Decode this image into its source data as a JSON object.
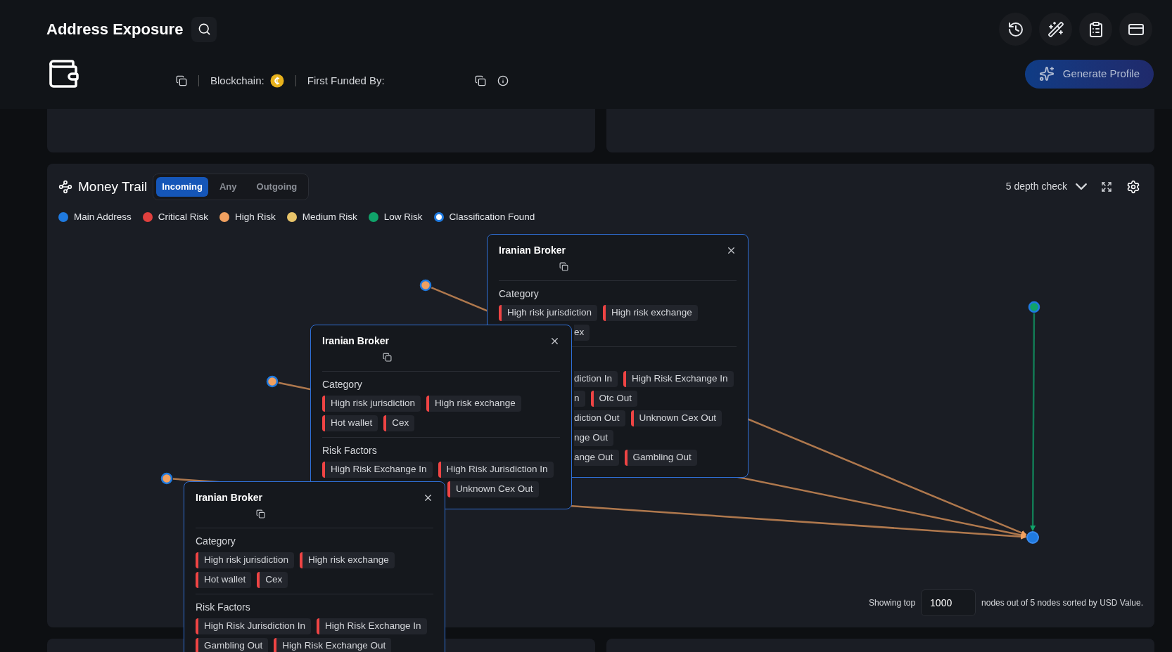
{
  "header": {
    "title": "Address Exposure",
    "blockchain_label": "Blockchain:",
    "funded_label": "First Funded By:",
    "generate_button": "Generate Profile"
  },
  "money_trail": {
    "title": "Money Trail",
    "tabs": [
      {
        "label": "Incoming",
        "selected": true
      },
      {
        "label": "Any",
        "selected": false
      },
      {
        "label": "Outgoing",
        "selected": false
      }
    ],
    "depth": "5 depth check",
    "legend": [
      {
        "label": "Main Address",
        "color": "#1f7ae0",
        "kind": "dot"
      },
      {
        "label": "Critical Risk",
        "color": "#e0403e",
        "kind": "dot"
      },
      {
        "label": "High Risk",
        "color": "#f0a060",
        "kind": "dot"
      },
      {
        "label": "Medium Risk",
        "color": "#e8c46a",
        "kind": "dot"
      },
      {
        "label": "Low Risk",
        "color": "#10a36a",
        "kind": "dot"
      },
      {
        "label": "Classification Found",
        "color": "#1f7ae0",
        "kind": "ring"
      }
    ],
    "nodes": [
      {
        "kind": "source",
        "color": "#f0a060"
      },
      {
        "kind": "source",
        "color": "#f0a060"
      },
      {
        "kind": "source",
        "color": "#f0a060"
      },
      {
        "kind": "source",
        "color": "#10a36a"
      },
      {
        "kind": "main",
        "color": "#1f7ae0"
      }
    ],
    "cards": [
      {
        "title": "Iranian Broker",
        "sections": [
          {
            "label": "Category",
            "rows": [
              {
                "covered": false,
                "tags": [
                  {
                    "text": "High risk jurisdiction",
                    "kind": "full"
                  },
                  {
                    "text": "High risk exchange",
                    "kind": "full"
                  }
                ]
              },
              {
                "covered": true,
                "tags": [
                  {
                    "text": "ex",
                    "kind": "clipped"
                  }
                ]
              }
            ]
          },
          {
            "rows": [
              {
                "covered": true,
                "tags": [
                  {
                    "text": "diction In",
                    "kind": "clipped"
                  },
                  {
                    "text": "High Risk Exchange In",
                    "kind": "full"
                  }
                ]
              },
              {
                "covered": true,
                "tags": [
                  {
                    "text": "n",
                    "kind": "clipped"
                  },
                  {
                    "text": "Otc Out",
                    "kind": "full"
                  }
                ]
              },
              {
                "covered": true,
                "tags": [
                  {
                    "text": "diction Out",
                    "kind": "clipped"
                  },
                  {
                    "text": "Unknown Cex Out",
                    "kind": "full"
                  }
                ]
              },
              {
                "covered": true,
                "tags": [
                  {
                    "text": "nge Out",
                    "kind": "clipped"
                  }
                ]
              },
              {
                "covered": true,
                "tags": [
                  {
                    "text": "ange Out",
                    "kind": "clipped"
                  },
                  {
                    "text": "Gambling Out",
                    "kind": "full"
                  }
                ]
              }
            ]
          }
        ]
      },
      {
        "title": "Iranian Broker",
        "sections": [
          {
            "label": "Category",
            "rows": [
              {
                "covered": false,
                "tags": [
                  {
                    "text": "High risk jurisdiction",
                    "kind": "full"
                  },
                  {
                    "text": "High risk exchange",
                    "kind": "full"
                  }
                ]
              },
              {
                "covered": false,
                "tags": [
                  {
                    "text": "Hot wallet",
                    "kind": "full"
                  },
                  {
                    "text": "Cex",
                    "kind": "full"
                  }
                ]
              }
            ]
          },
          {
            "label": "Risk Factors",
            "rows": [
              {
                "covered": false,
                "tags": [
                  {
                    "text": "High Risk Exchange In",
                    "kind": "full"
                  },
                  {
                    "text": "High Risk Jurisdiction In",
                    "kind": "full"
                  }
                ]
              },
              {
                "covered": true,
                "tags": [
                  {
                    "text": "Unknown Cex Out",
                    "kind": "full"
                  }
                ]
              }
            ]
          }
        ]
      },
      {
        "title": "Iranian Broker",
        "sections": [
          {
            "label": "Category",
            "rows": [
              {
                "covered": false,
                "tags": [
                  {
                    "text": "High risk jurisdiction",
                    "kind": "full"
                  },
                  {
                    "text": "High risk exchange",
                    "kind": "full"
                  }
                ]
              },
              {
                "covered": false,
                "tags": [
                  {
                    "text": "Hot wallet",
                    "kind": "full"
                  },
                  {
                    "text": "Cex",
                    "kind": "full"
                  }
                ]
              }
            ]
          },
          {
            "label": "Risk Factors",
            "rows": [
              {
                "covered": false,
                "tags": [
                  {
                    "text": "High Risk Jurisdiction In",
                    "kind": "full"
                  },
                  {
                    "text": "High Risk Exchange In",
                    "kind": "full"
                  }
                ]
              },
              {
                "covered": false,
                "tags": [
                  {
                    "text": "Gambling Out",
                    "kind": "full"
                  },
                  {
                    "text": "High Risk Exchange Out",
                    "kind": "full"
                  }
                ]
              }
            ]
          }
        ]
      }
    ],
    "footer": {
      "prefix": "Showing top",
      "value": "1000",
      "suffix": "nodes out of 5 nodes sorted by USD Value."
    }
  }
}
